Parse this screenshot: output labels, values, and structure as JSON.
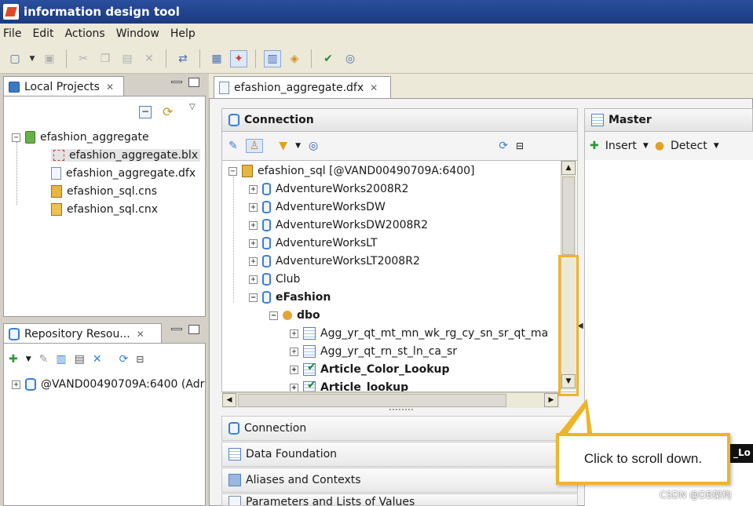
{
  "window": {
    "title": "information design tool"
  },
  "menu": [
    "File",
    "Edit",
    "Actions",
    "Window",
    "Help"
  ],
  "local_projects": {
    "tab_label": "Local Projects",
    "project": "efashion_aggregate",
    "files": [
      "efashion_aggregate.blx",
      "efashion_aggregate.dfx",
      "efashion_sql.cns",
      "efashion_sql.cnx"
    ]
  },
  "repository": {
    "tab_label": "Repository Resou...",
    "server": "@VAND00490709A:6400 (Adr"
  },
  "editor": {
    "tab_label": "efashion_aggregate.dfx",
    "connection_header": "Connection",
    "master_header": "Master",
    "insert_label": "Insert",
    "detect_label": "Detect",
    "root": "efashion_sql [@VAND00490709A:6400]",
    "databases": [
      "AdventureWorks2008R2",
      "AdventureWorksDW",
      "AdventureWorksDW2008R2",
      "AdventureWorksLT",
      "AdventureWorksLT2008R2",
      "Club"
    ],
    "efashion": "eFashion",
    "schema": "dbo",
    "tables": [
      "Agg_yr_qt_mt_mn_wk_rg_cy_sn_sr_qt_ma",
      "Agg_yr_qt_rn_st_ln_ca_sr",
      "Article_Color_Lookup",
      "Article_lookup"
    ]
  },
  "accordion": [
    "Connection",
    "Data Foundation",
    "Aliases and Contexts",
    "Parameters and Lists of Values"
  ],
  "callout": {
    "text": "Click to scroll down."
  },
  "watermark": "CSDN @DB架构",
  "colors": {
    "accent": "#f0b429",
    "titlebar": "#1d3a80"
  }
}
